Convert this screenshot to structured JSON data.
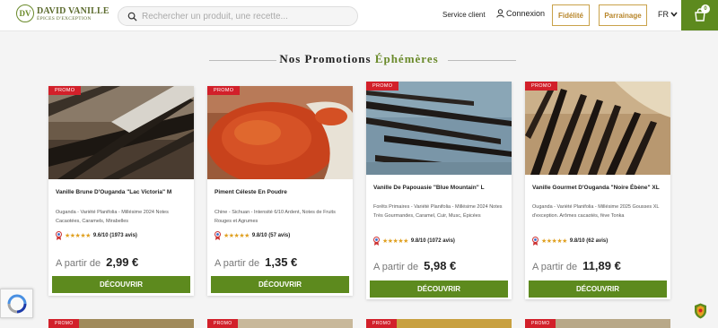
{
  "header": {
    "logo": {
      "name": "DAVID VANILLE",
      "tagline": "ÉPICES D'EXCEPTION",
      "mark": "DV"
    },
    "search_placeholder": "Rechercher un produit, une recette...",
    "service_client": "Service client",
    "login": "Connexion",
    "fidelite": "Fidélité",
    "parrainage": "Parrainage",
    "language": "FR",
    "cart_count": "0"
  },
  "section": {
    "title_main": "Nos Promotions",
    "title_accent": "Éphémères"
  },
  "products": [
    {
      "badge": "PROMO",
      "name": "Vanille Brune D'Ouganda \"Lac Victoria\" M",
      "desc": "Ouganda - Variété Planifolia - Millésime 2024 Notes Cacaotées, Caramels, Mirabelles",
      "stars": "★★★★★",
      "rating": "9.6/10 (1973 avis)",
      "price_prefix": "A partir de",
      "price": "2,99 €",
      "cta": "DÉCOUVRIR"
    },
    {
      "badge": "PROMO",
      "name": "Piment Céleste En Poudre",
      "desc": "Chine - Sichuan - Intensité 6/10 Ardent, Notes de Fruits Rouges et Agrumes",
      "stars": "★★★★★",
      "rating": "9.8/10 (57 avis)",
      "price_prefix": "A partir de",
      "price": "1,35 €",
      "cta": "DÉCOUVRIR"
    },
    {
      "badge": "PROMO",
      "name": "Vanille De Papouasie \"Blue Mountain\" L",
      "desc": "Forêts Primaires - Variété Planifolia - Millésime 2024 Notes Très Gourmandes, Caramel, Cuir, Musc, Épicées",
      "stars": "★★★★★",
      "rating": "9.8/10 (1072 avis)",
      "price_prefix": "A partir de",
      "price": "5,98 €",
      "cta": "DÉCOUVRIR"
    },
    {
      "badge": "PROMO",
      "name": "Vanille Gourmet D'Ouganda \"Noire Ébène\" XL",
      "desc": "Ouganda - Variété Planifolia - Millésime 2025 Gousses XL d'exception. Arômes cacaotés, fève Tonka",
      "stars": "★★★★★",
      "rating": "9.8/10 (62 avis)",
      "price_prefix": "A partir de",
      "price": "11,89 €",
      "cta": "DÉCOUVRIR"
    }
  ],
  "second_row_badge": "PROMO",
  "colors": {
    "brand_green": "#5d8a1e",
    "gold": "#c9a24a",
    "promo_red": "#d2202a"
  }
}
